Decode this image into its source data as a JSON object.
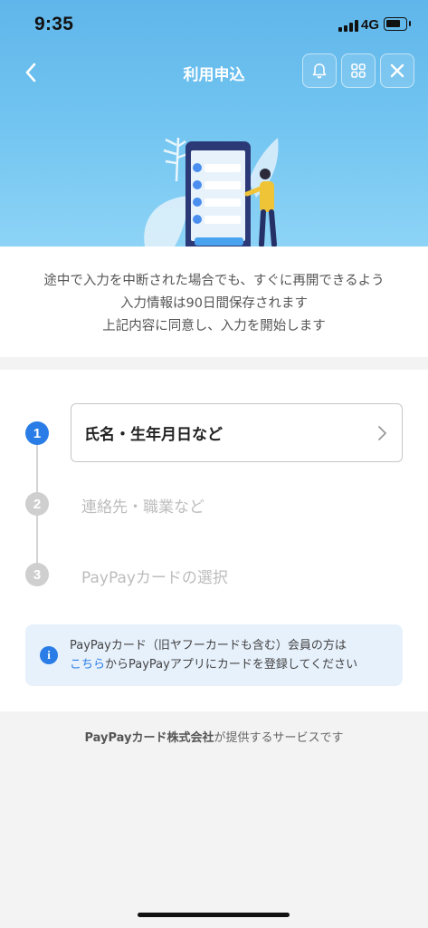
{
  "status": {
    "time": "9:35",
    "network": "4G"
  },
  "header": {
    "title": "利用申込"
  },
  "intro": {
    "line1": "途中で入力を中断された場合でも、すぐに再開できるよう",
    "line2": "入力情報は90日間保存されます",
    "line3": "上記内容に同意し、入力を開始します"
  },
  "steps": [
    {
      "number": "1",
      "label": "氏名・生年月日など",
      "state": "active"
    },
    {
      "number": "2",
      "label": "連絡先・職業など",
      "state": "inactive"
    },
    {
      "number": "3",
      "label": "PayPayカードの選択",
      "state": "inactive"
    }
  ],
  "notice": {
    "line1": "PayPayカード（旧ヤフーカードも含む）会員の方は",
    "link": "こちら",
    "line2_rest": "からPayPayアプリにカードを登録してください"
  },
  "footer": {
    "company": "PayPayカード株式会社",
    "suffix": "が提供するサービスです"
  },
  "colors": {
    "accent": "#2a7de6",
    "header_bg": "#6dc0ef"
  },
  "icons": [
    "back-chevron-icon",
    "bell-icon",
    "grid-icon",
    "close-icon",
    "chevron-right-icon",
    "info-icon"
  ]
}
